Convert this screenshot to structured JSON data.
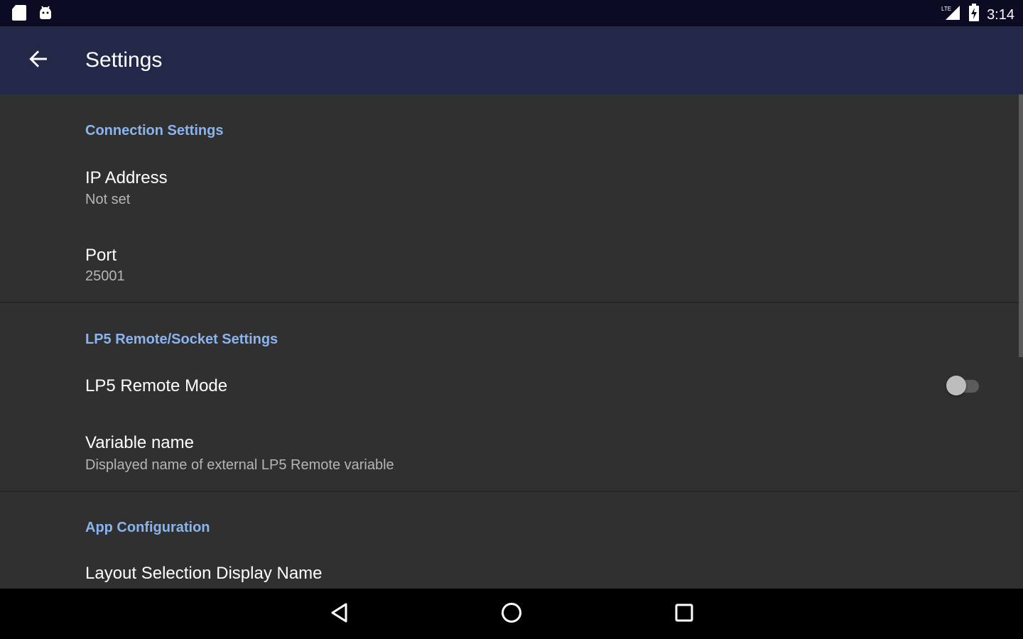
{
  "status_bar": {
    "time": "3:14",
    "icons": [
      "sd-card-icon",
      "android-debug-icon",
      "signal-icon",
      "battery-charging-icon"
    ]
  },
  "app_bar": {
    "title": "Settings",
    "back_icon": "arrow-back-icon"
  },
  "sections": [
    {
      "header": "Connection Settings",
      "items": [
        {
          "title": "IP Address",
          "summary": "Not set"
        },
        {
          "title": "Port",
          "summary": "25001"
        }
      ]
    },
    {
      "header": "LP5 Remote/Socket Settings",
      "items": [
        {
          "title": "LP5 Remote Mode",
          "switch_on": false
        },
        {
          "title": "Variable name",
          "summary": "Displayed name of external LP5 Remote variable"
        }
      ]
    },
    {
      "header": "App Configuration",
      "items": [
        {
          "title": "Layout Selection Display Name"
        }
      ]
    }
  ],
  "nav_bar": {
    "buttons": [
      "back-triangle-icon",
      "home-circle-icon",
      "recents-square-icon"
    ]
  },
  "colors": {
    "status_bar": "#0b0b24",
    "app_bar": "#232748",
    "background": "#303030",
    "accent": "#8ab4f0",
    "primary_text": "#ffffff",
    "secondary_text": "#b5b5b5"
  }
}
